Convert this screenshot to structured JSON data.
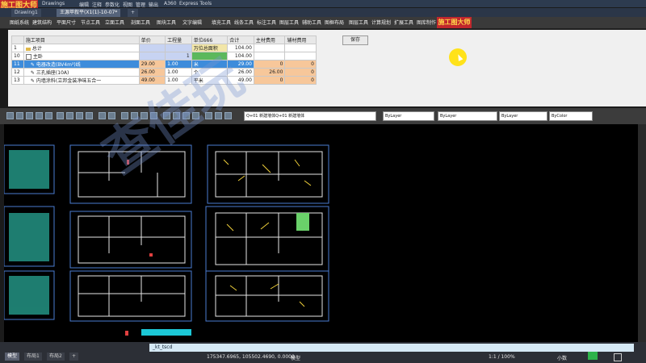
{
  "app": {
    "logo_text": "施工图大师",
    "menus": [
      "Drawings",
      "编辑",
      "注释",
      "参数化",
      "视图",
      "管理",
      "输出",
      "A360",
      "Express Tools"
    ],
    "tabs": [
      {
        "label": "Drawing1",
        "active": false
      },
      {
        "label": "王源苹叙平(X1(1)-10-07*",
        "active": true
      },
      {
        "label": "+",
        "active": false
      }
    ],
    "plugin_menus": [
      "图纸系统",
      "建筑结构",
      "平面尺寸",
      "节点工具",
      "立面工具",
      "剖面工具",
      "图块工具",
      "文字编辑",
      "填充工具",
      "线条工具",
      "标注工具",
      "图层工具",
      "辅助工具",
      "图框布局",
      "图层工具",
      "计算规划",
      "扩展工具",
      "图库制作"
    ],
    "brand_button": "施工图大师"
  },
  "grid": {
    "headers": [
      "施工项目",
      "单价",
      "工程量",
      "单位666",
      "合计",
      "主材费用",
      "辅材费用"
    ],
    "rows": [
      {
        "num": "1",
        "name": "总计",
        "price": "",
        "qty": "",
        "unit": "万位总面积",
        "total": "104.00",
        "main": "",
        "aux": ""
      },
      {
        "num": "10",
        "name": "主卧",
        "price": "",
        "qty": "1",
        "unit": "",
        "total": "104.00",
        "main": "",
        "aux": ""
      },
      {
        "num": "11",
        "name": "电器改造(BV4m²)线",
        "price": "29.00",
        "qty": "1.00",
        "unit": "米",
        "total": "29.00",
        "main": "0",
        "aux": "0"
      },
      {
        "num": "12",
        "name": "三孔插座(10A)",
        "price": "26.00",
        "qty": "1.00",
        "unit": "个",
        "total": "26.00",
        "main": "26.00",
        "aux": "0"
      },
      {
        "num": "13",
        "name": "内墙涂料(立邦金装净味五合一",
        "price": "49.00",
        "qty": "1.00",
        "unit": "平米",
        "total": "49.00",
        "main": "0",
        "aux": "0"
      }
    ],
    "save_label": "保存"
  },
  "cad": {
    "layer_dropdown": "Q+01 新建墙体Q+01 新建墙体",
    "color_dropdown": "ByLayer",
    "linetype_dropdown": "ByLayer",
    "lineweight_dropdown": "ByLayer",
    "plot_dropdown": "ByColor"
  },
  "status": {
    "layout_tabs": [
      {
        "label": "模型",
        "active": true
      },
      {
        "label": "布局1",
        "active": false
      },
      {
        "label": "布局2",
        "active": false
      },
      {
        "label": "+",
        "active": false
      }
    ],
    "command_text": "_kt_tscd",
    "coordinates": "175347.6965, 105502.4690, 0.0000",
    "scale": "1:1 / 100%",
    "units": "小数",
    "model_label": "模型"
  },
  "colors": {
    "accent_red": "#c1272d",
    "row_highlight": "#3d8cdb",
    "orange_cell": "#f7c79a",
    "green_cell": "#5cb85c",
    "cursor_highlight": "#ffe21a"
  }
}
